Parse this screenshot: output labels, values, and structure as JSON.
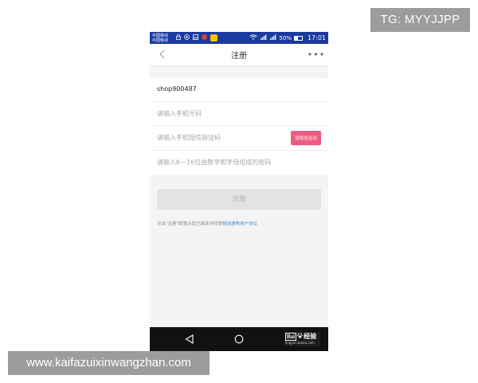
{
  "watermarks": {
    "top_right": "TG: MYYJJPP",
    "bottom_left": "www.kaifazuixinwangzhan.com"
  },
  "statusbar": {
    "carrier_1": "中国移动",
    "carrier_2": "中国移动",
    "battery_text": "50%",
    "battery_level": 0.5,
    "time": "17:01"
  },
  "navbar": {
    "title": "注册",
    "more": "•••"
  },
  "form": {
    "username_value": "shop900487",
    "phone_placeholder": "请输入手机号码",
    "sms_placeholder": "请输入手机短信验证码",
    "get_code_label": "获取验证码",
    "password_placeholder": "请输入6－16位由数字和字母组成的密码"
  },
  "register_button": "注册",
  "agreement": {
    "prefix": "点击\"注册\"即表示您已阅读并同意",
    "link": "精选速购用户协议"
  },
  "bottom_logo": {
    "brand_a": "Bai",
    "brand_b": "经验",
    "url": "jingyan.baidu.com"
  },
  "colors": {
    "statusbar_bg": "#1a3aa0",
    "accent_pink": "#f05a7e",
    "link_blue": "#3a8fd8"
  }
}
